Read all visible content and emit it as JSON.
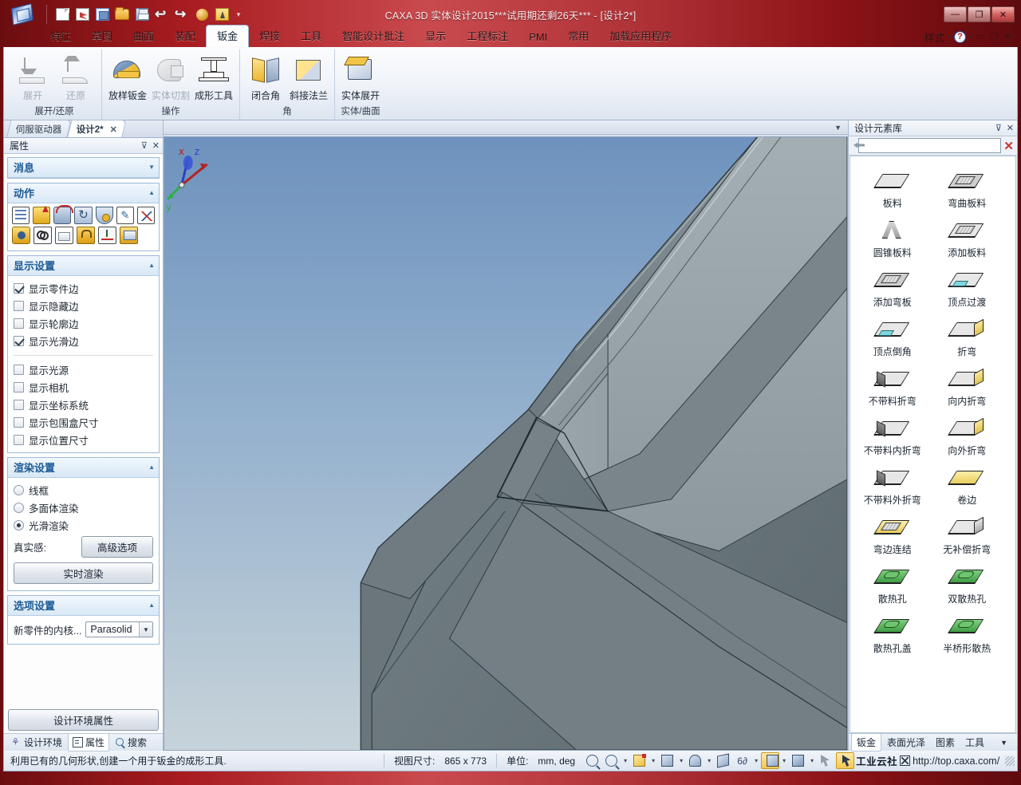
{
  "window": {
    "title": "CAXA 3D 实体设计2015***试用期还剩26天*** - [设计2*]",
    "minimize": "—",
    "maximize": "❐",
    "close": "✕"
  },
  "quick_access": [
    {
      "name": "new-file-icon",
      "tip": "新建"
    },
    {
      "name": "new-sheet-icon",
      "tip": "新建图纸"
    },
    {
      "name": "open-image-icon",
      "tip": "打开"
    },
    {
      "name": "open-folder-icon",
      "tip": "打开文件"
    },
    {
      "name": "save-icon",
      "tip": "保存"
    },
    {
      "name": "undo-icon",
      "tip": "撤销"
    },
    {
      "name": "redo-icon",
      "tip": "重做"
    },
    {
      "name": "sphere-icon",
      "tip": "球体"
    },
    {
      "name": "wizard-icon",
      "tip": "设计向导"
    }
  ],
  "menu": {
    "tabs": [
      {
        "label": "特征",
        "active": false
      },
      {
        "label": "草图",
        "active": false
      },
      {
        "label": "曲面",
        "active": false
      },
      {
        "label": "装配",
        "active": false
      },
      {
        "label": "钣金",
        "active": true
      },
      {
        "label": "焊接",
        "active": false
      },
      {
        "label": "工具",
        "active": false
      },
      {
        "label": "智能设计批注",
        "active": false
      },
      {
        "label": "显示",
        "active": false
      },
      {
        "label": "工程标注",
        "active": false
      },
      {
        "label": "PMI",
        "active": false
      },
      {
        "label": "常用",
        "active": false
      },
      {
        "label": "加载应用程序",
        "active": false
      }
    ],
    "style_label": "样式"
  },
  "ribbon": {
    "groups": [
      {
        "label": "展开/还原",
        "buttons": [
          {
            "label": "展开",
            "icon": "unfold-icon",
            "disabled": true
          },
          {
            "label": "还原",
            "icon": "restore-icon",
            "disabled": true
          }
        ]
      },
      {
        "label": "操作",
        "buttons": [
          {
            "label": "放样钣金",
            "icon": "loft-sheetmetal-icon",
            "disabled": false
          },
          {
            "label": "实体切割",
            "icon": "solid-cut-icon",
            "disabled": true
          },
          {
            "label": "成形工具",
            "icon": "forming-tool-icon",
            "disabled": false
          }
        ]
      },
      {
        "label": "角",
        "buttons": [
          {
            "label": "闭合角",
            "icon": "closed-corner-icon",
            "disabled": false
          },
          {
            "label": "斜接法兰",
            "icon": "miter-flange-icon",
            "disabled": false
          }
        ]
      },
      {
        "label": "实体/曲面",
        "buttons": [
          {
            "label": "实体展开",
            "icon": "solid-unfold-icon",
            "disabled": false
          }
        ]
      }
    ]
  },
  "left_panel": {
    "doc_tabs": [
      {
        "label": "伺服驱动器",
        "active": false
      },
      {
        "label": "设计2*",
        "active": true
      }
    ],
    "doc_tab_close": "✕",
    "header": {
      "title": "属性",
      "pin": "⊽",
      "close": "✕"
    },
    "sections": [
      {
        "name": "messages",
        "title": "消息",
        "collapsed": true
      },
      {
        "name": "actions",
        "title": "动作",
        "collapsed": false
      },
      {
        "name": "display-settings",
        "title": "显示设置",
        "collapsed": false
      },
      {
        "name": "render-settings",
        "title": "渲染设置",
        "collapsed": false
      },
      {
        "name": "option-settings",
        "title": "选项设置",
        "collapsed": false
      }
    ],
    "action_icons_row1": [
      "list-icon",
      "extrude-icon",
      "revolve-icon",
      "sweep-icon",
      "loft-icon",
      "sketch-edit-icon",
      "curve-icon"
    ],
    "action_icons_row2": [
      "render-cube-icon",
      "link-icon",
      "table-icon",
      "lock-icon",
      "axis-icon",
      "box-icon"
    ],
    "display_settings": {
      "group1": [
        {
          "label": "显示零件边",
          "checked": true
        },
        {
          "label": "显示隐藏边",
          "checked": false
        },
        {
          "label": "显示轮廓边",
          "checked": false
        },
        {
          "label": "显示光滑边",
          "checked": true
        }
      ],
      "group2": [
        {
          "label": "显示光源",
          "checked": false
        },
        {
          "label": "显示相机",
          "checked": false
        },
        {
          "label": "显示坐标系统",
          "checked": false
        },
        {
          "label": "显示包围盒尺寸",
          "checked": false
        },
        {
          "label": "显示位置尺寸",
          "checked": false
        }
      ]
    },
    "render_settings": {
      "radios": [
        {
          "label": "线框",
          "selected": false
        },
        {
          "label": "多面体渲染",
          "selected": false
        },
        {
          "label": "光滑渲染",
          "selected": true
        }
      ],
      "realism_label": "真实感:",
      "advanced_button": "高级选项",
      "realtime_button": "实时渲染"
    },
    "option_settings": {
      "kernel_label": "新零件的内核...",
      "kernel_value": "Parasolid"
    },
    "env_properties_button": "设计环境属性",
    "bottom_tabs": [
      {
        "label": "设计环境",
        "icon": "design-env-icon",
        "active": false
      },
      {
        "label": "属性",
        "icon": "properties-icon",
        "active": true
      },
      {
        "label": "搜索",
        "icon": "search-icon",
        "active": false
      }
    ]
  },
  "right_panel": {
    "header": {
      "title": "设计元素库",
      "pin": "⊽",
      "close": "✕"
    },
    "search_value": "",
    "clear_label": "✕",
    "items": [
      {
        "label": "板料",
        "icon": "plate-icon",
        "style": "plain"
      },
      {
        "label": "弯曲板料",
        "icon": "bent-plate-icon",
        "style": "bent"
      },
      {
        "label": "圆锥板料",
        "icon": "conical-plate-icon",
        "style": "cone"
      },
      {
        "label": "添加板料",
        "icon": "add-plate-icon",
        "style": "addplate"
      },
      {
        "label": "添加弯板",
        "icon": "add-bend-icon",
        "style": "bent"
      },
      {
        "label": "顶点过渡",
        "icon": "vertex-blend-icon",
        "style": "cyan"
      },
      {
        "label": "顶点倒角",
        "icon": "vertex-chamfer-icon",
        "style": "cyan"
      },
      {
        "label": "折弯",
        "icon": "bend-icon",
        "style": "yfold"
      },
      {
        "label": "不带料折弯",
        "icon": "bend-no-material-icon",
        "style": "dark"
      },
      {
        "label": "向内折弯",
        "icon": "inward-bend-icon",
        "style": "yfold"
      },
      {
        "label": "不带料内折弯",
        "icon": "inward-bend-no-material-icon",
        "style": "dark"
      },
      {
        "label": "向外折弯",
        "icon": "outward-bend-icon",
        "style": "yfold"
      },
      {
        "label": "不带料外折弯",
        "icon": "outward-bend-no-material-icon",
        "style": "dark"
      },
      {
        "label": "卷边",
        "icon": "hem-icon",
        "style": "yellow"
      },
      {
        "label": "弯边连结",
        "icon": "bend-joint-icon",
        "style": "yellow"
      },
      {
        "label": "无补偿折弯",
        "icon": "no-compensation-bend-icon",
        "style": "plain"
      },
      {
        "label": "散热孔",
        "icon": "louver-icon",
        "style": "green"
      },
      {
        "label": "双散热孔",
        "icon": "double-louver-icon",
        "style": "green"
      },
      {
        "label": "散热孔盖",
        "icon": "louver-cover-icon",
        "style": "green"
      },
      {
        "label": "半桥形散热",
        "icon": "half-bridge-louver-icon",
        "style": "green"
      }
    ],
    "bottom_tabs": [
      {
        "label": "钣金",
        "active": true
      },
      {
        "label": "表面光泽",
        "active": false
      },
      {
        "label": "图素",
        "active": false
      },
      {
        "label": "工具",
        "active": false
      }
    ],
    "more_tabs": "▼"
  },
  "viewport": {
    "axis": {
      "x": "x",
      "y": "y",
      "z": "z"
    },
    "background_top": "#7f9fc4",
    "background_bottom": "#c4d2dc",
    "model_color": "#6f7b80"
  },
  "status_bar": {
    "message": "利用已有的几何形状,创建一个用于钣金的成形工具.",
    "view_size_label": "视图尺寸:",
    "view_size_value": "865 x 773",
    "units_label": "单位:",
    "units_value": "mm, deg",
    "tools": [
      {
        "name": "zoom-in-icon",
        "has_caret": false
      },
      {
        "name": "zoom-window-icon",
        "has_caret": true
      },
      {
        "name": "view-orientation-icon",
        "has_caret": true
      },
      {
        "name": "render-mode-icon",
        "has_caret": true
      },
      {
        "name": "camera-icon",
        "has_caret": true
      },
      {
        "name": "perspective-icon",
        "has_caret": false
      },
      {
        "name": "glasses-icon",
        "has_caret": true
      },
      {
        "name": "shaded-cube-icon",
        "has_caret": true,
        "selected": true
      },
      {
        "name": "shading-icon",
        "has_caret": true
      },
      {
        "name": "drag-icon",
        "has_caret": false
      },
      {
        "name": "select-arrow-icon",
        "has_caret": false,
        "selected": true
      }
    ],
    "watermark_text": "工业云社",
    "watermark_url": "http://top.caxa.com/"
  }
}
